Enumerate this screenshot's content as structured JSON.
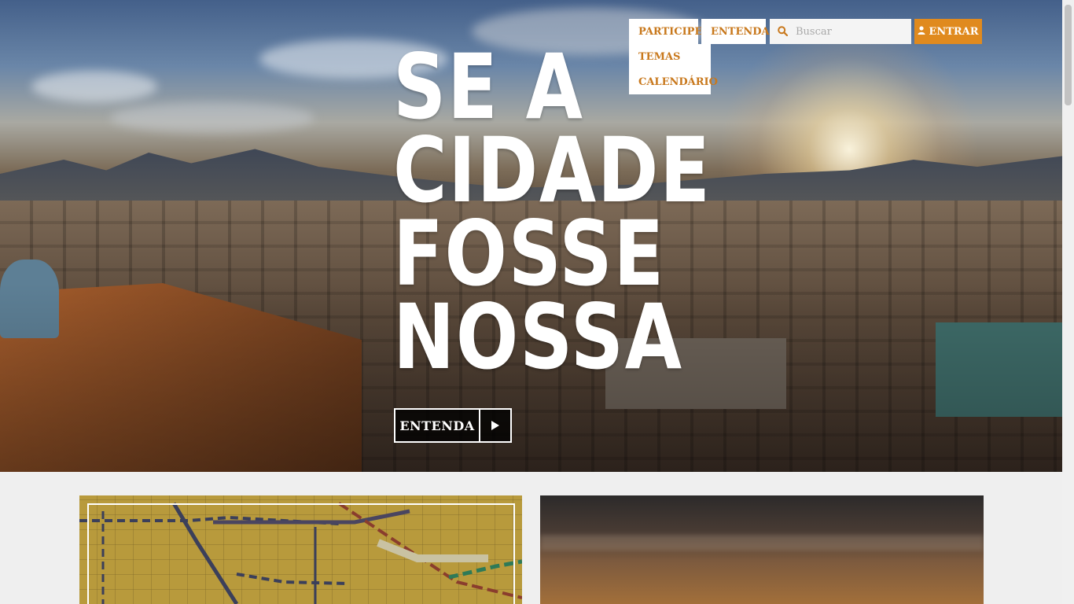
{
  "hero": {
    "headline": [
      "SE A",
      "CIDADE",
      "FOSSE",
      "NOSSA"
    ],
    "cta_label": "ENTENDA",
    "cta_icon": "play-icon"
  },
  "nav": {
    "items": [
      {
        "label": "PARTICIPE"
      },
      {
        "label": "ENTENDA"
      }
    ],
    "dropdown": [
      {
        "label": "TEMAS"
      },
      {
        "label": "CALENDÁRIO"
      }
    ],
    "search": {
      "placeholder": "Buscar",
      "icon": "search-icon"
    },
    "login": {
      "label": "ENTRAR",
      "icon": "user-icon"
    }
  },
  "colors": {
    "accent": "#e08a1e",
    "nav_text": "#c8781c",
    "background": "#efefef"
  },
  "cards": [
    {
      "name": "map-card"
    },
    {
      "name": "sunset-card"
    }
  ]
}
